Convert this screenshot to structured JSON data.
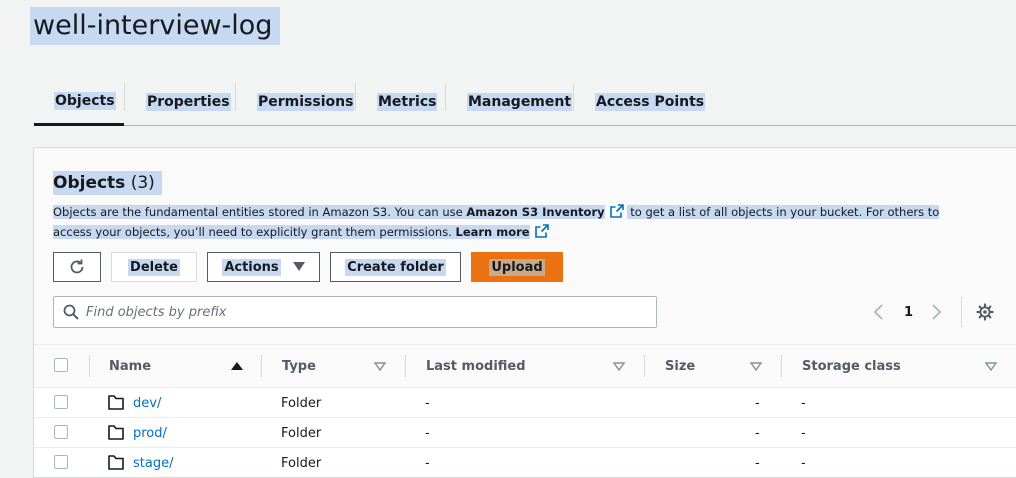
{
  "header": {
    "title": "well-interview-log"
  },
  "tabs": [
    {
      "label": "Objects",
      "active": true
    },
    {
      "label": "Properties"
    },
    {
      "label": "Permissions"
    },
    {
      "label": "Metrics"
    },
    {
      "label": "Management"
    },
    {
      "label": "Access Points"
    }
  ],
  "objects": {
    "heading": "Objects",
    "count": "(3)",
    "description": {
      "part1": "Objects are the fundamental entities stored in Amazon S3. You can use ",
      "inventory_link": "Amazon S3 Inventory",
      "part2": " to get a list of all objects in your bucket. For others to access your objects, you’ll need to explicitly grant them permissions. ",
      "learn_more": "Learn more"
    },
    "toolbar": {
      "delete": "Delete",
      "actions": "Actions",
      "create_folder": "Create folder",
      "upload": "Upload"
    },
    "search": {
      "placeholder": "Find objects by prefix"
    },
    "pagination": {
      "page": "1"
    },
    "columns": [
      "Name",
      "Type",
      "Last modified",
      "Size",
      "Storage class"
    ],
    "rows": [
      {
        "name": "dev/",
        "type": "Folder",
        "last_modified": "-",
        "size": "-",
        "storage_class": "-"
      },
      {
        "name": "prod/",
        "type": "Folder",
        "last_modified": "-",
        "size": "-",
        "storage_class": "-"
      },
      {
        "name": "stage/",
        "type": "Folder",
        "last_modified": "-",
        "size": "-",
        "storage_class": "-"
      }
    ]
  },
  "colors": {
    "accent": "#ec7211",
    "link": "#0073bb",
    "selection": "#c6d9f0"
  },
  "icons": [
    "refresh-icon",
    "caret-down-icon",
    "search-icon",
    "chevron-left-icon",
    "chevron-right-icon",
    "gear-icon",
    "external-link-icon",
    "folder-icon",
    "sort-ascending-icon",
    "sort-icon"
  ]
}
